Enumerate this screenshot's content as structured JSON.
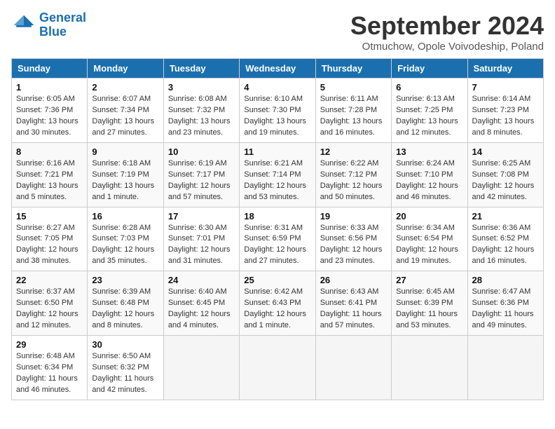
{
  "header": {
    "logo_line1": "General",
    "logo_line2": "Blue",
    "month": "September 2024",
    "location": "Otmuchow, Opole Voivodeship, Poland"
  },
  "weekdays": [
    "Sunday",
    "Monday",
    "Tuesday",
    "Wednesday",
    "Thursday",
    "Friday",
    "Saturday"
  ],
  "weeks": [
    [
      {
        "day": "1",
        "sunrise": "6:05 AM",
        "sunset": "7:36 PM",
        "daylight": "13 hours and 30 minutes."
      },
      {
        "day": "2",
        "sunrise": "6:07 AM",
        "sunset": "7:34 PM",
        "daylight": "13 hours and 27 minutes."
      },
      {
        "day": "3",
        "sunrise": "6:08 AM",
        "sunset": "7:32 PM",
        "daylight": "13 hours and 23 minutes."
      },
      {
        "day": "4",
        "sunrise": "6:10 AM",
        "sunset": "7:30 PM",
        "daylight": "13 hours and 19 minutes."
      },
      {
        "day": "5",
        "sunrise": "6:11 AM",
        "sunset": "7:28 PM",
        "daylight": "13 hours and 16 minutes."
      },
      {
        "day": "6",
        "sunrise": "6:13 AM",
        "sunset": "7:25 PM",
        "daylight": "13 hours and 12 minutes."
      },
      {
        "day": "7",
        "sunrise": "6:14 AM",
        "sunset": "7:23 PM",
        "daylight": "13 hours and 8 minutes."
      }
    ],
    [
      {
        "day": "8",
        "sunrise": "6:16 AM",
        "sunset": "7:21 PM",
        "daylight": "13 hours and 5 minutes."
      },
      {
        "day": "9",
        "sunrise": "6:18 AM",
        "sunset": "7:19 PM",
        "daylight": "13 hours and 1 minute."
      },
      {
        "day": "10",
        "sunrise": "6:19 AM",
        "sunset": "7:17 PM",
        "daylight": "12 hours and 57 minutes."
      },
      {
        "day": "11",
        "sunrise": "6:21 AM",
        "sunset": "7:14 PM",
        "daylight": "12 hours and 53 minutes."
      },
      {
        "day": "12",
        "sunrise": "6:22 AM",
        "sunset": "7:12 PM",
        "daylight": "12 hours and 50 minutes."
      },
      {
        "day": "13",
        "sunrise": "6:24 AM",
        "sunset": "7:10 PM",
        "daylight": "12 hours and 46 minutes."
      },
      {
        "day": "14",
        "sunrise": "6:25 AM",
        "sunset": "7:08 PM",
        "daylight": "12 hours and 42 minutes."
      }
    ],
    [
      {
        "day": "15",
        "sunrise": "6:27 AM",
        "sunset": "7:05 PM",
        "daylight": "12 hours and 38 minutes."
      },
      {
        "day": "16",
        "sunrise": "6:28 AM",
        "sunset": "7:03 PM",
        "daylight": "12 hours and 35 minutes."
      },
      {
        "day": "17",
        "sunrise": "6:30 AM",
        "sunset": "7:01 PM",
        "daylight": "12 hours and 31 minutes."
      },
      {
        "day": "18",
        "sunrise": "6:31 AM",
        "sunset": "6:59 PM",
        "daylight": "12 hours and 27 minutes."
      },
      {
        "day": "19",
        "sunrise": "6:33 AM",
        "sunset": "6:56 PM",
        "daylight": "12 hours and 23 minutes."
      },
      {
        "day": "20",
        "sunrise": "6:34 AM",
        "sunset": "6:54 PM",
        "daylight": "12 hours and 19 minutes."
      },
      {
        "day": "21",
        "sunrise": "6:36 AM",
        "sunset": "6:52 PM",
        "daylight": "12 hours and 16 minutes."
      }
    ],
    [
      {
        "day": "22",
        "sunrise": "6:37 AM",
        "sunset": "6:50 PM",
        "daylight": "12 hours and 12 minutes."
      },
      {
        "day": "23",
        "sunrise": "6:39 AM",
        "sunset": "6:48 PM",
        "daylight": "12 hours and 8 minutes."
      },
      {
        "day": "24",
        "sunrise": "6:40 AM",
        "sunset": "6:45 PM",
        "daylight": "12 hours and 4 minutes."
      },
      {
        "day": "25",
        "sunrise": "6:42 AM",
        "sunset": "6:43 PM",
        "daylight": "12 hours and 1 minute."
      },
      {
        "day": "26",
        "sunrise": "6:43 AM",
        "sunset": "6:41 PM",
        "daylight": "11 hours and 57 minutes."
      },
      {
        "day": "27",
        "sunrise": "6:45 AM",
        "sunset": "6:39 PM",
        "daylight": "11 hours and 53 minutes."
      },
      {
        "day": "28",
        "sunrise": "6:47 AM",
        "sunset": "6:36 PM",
        "daylight": "11 hours and 49 minutes."
      }
    ],
    [
      {
        "day": "29",
        "sunrise": "6:48 AM",
        "sunset": "6:34 PM",
        "daylight": "11 hours and 46 minutes."
      },
      {
        "day": "30",
        "sunrise": "6:50 AM",
        "sunset": "6:32 PM",
        "daylight": "11 hours and 42 minutes."
      },
      null,
      null,
      null,
      null,
      null
    ]
  ]
}
